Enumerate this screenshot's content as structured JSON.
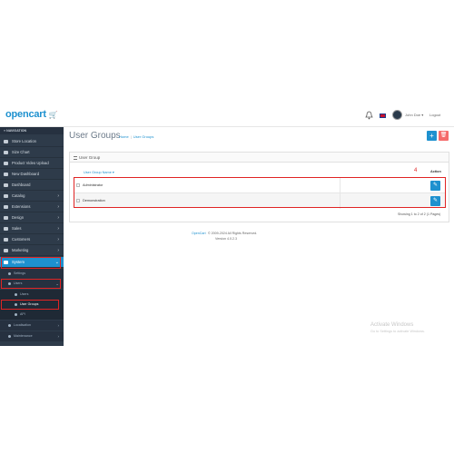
{
  "header": {
    "logo_text": "opencart",
    "logo_cart": "🛒",
    "user_name": "John Doe ▾",
    "logout": "Logout"
  },
  "sidebar": {
    "heading": "≡ NAVIGATION",
    "items": [
      {
        "label": "Store Location"
      },
      {
        "label": "Size Chart"
      },
      {
        "label": "Product Video Upload"
      },
      {
        "label": "New Dashboard"
      },
      {
        "label": "Dashboard"
      },
      {
        "label": "Catalog",
        "chevron": "›"
      },
      {
        "label": "Extensions",
        "chevron": "›"
      },
      {
        "label": "Design",
        "chevron": "›"
      },
      {
        "label": "Sales",
        "chevron": "›"
      },
      {
        "label": "Customers",
        "chevron": "›"
      },
      {
        "label": "Marketing",
        "chevron": "›"
      },
      {
        "label": "System",
        "chevron": "⌄"
      }
    ],
    "sub_items": [
      {
        "label": "Settings"
      },
      {
        "label": "Users",
        "chevron": "⌄"
      }
    ],
    "subsub_items": [
      {
        "label": "Users"
      },
      {
        "label": "User Groups"
      },
      {
        "label": "API"
      }
    ],
    "more_items": [
      {
        "label": "Localisation",
        "chevron": "›"
      },
      {
        "label": "Maintenance",
        "chevron": "›"
      }
    ]
  },
  "page": {
    "title": "User Groups",
    "breadcrumb_home": "Home",
    "breadcrumb_current": "User Groups",
    "add_icon": "+",
    "delete_icon": "🗑"
  },
  "panel": {
    "heading": "User Group",
    "col_name": "User Group Name ▾",
    "col_action": "Action",
    "annotation": "4",
    "rows": [
      {
        "name": "Administrator"
      },
      {
        "name": "Demonstration"
      }
    ],
    "edit_icon": "✎",
    "showing": "Showing 1 to 2 of 2 (1 Pages)"
  },
  "footer": {
    "link": "OpenCart",
    "rest": "© 2009-2024 All Rights Reserved.",
    "version": "Version 4.0.2.3"
  },
  "watermark": {
    "line1": "Activate Windows",
    "line2": "Go to Settings to activate Windows."
  }
}
